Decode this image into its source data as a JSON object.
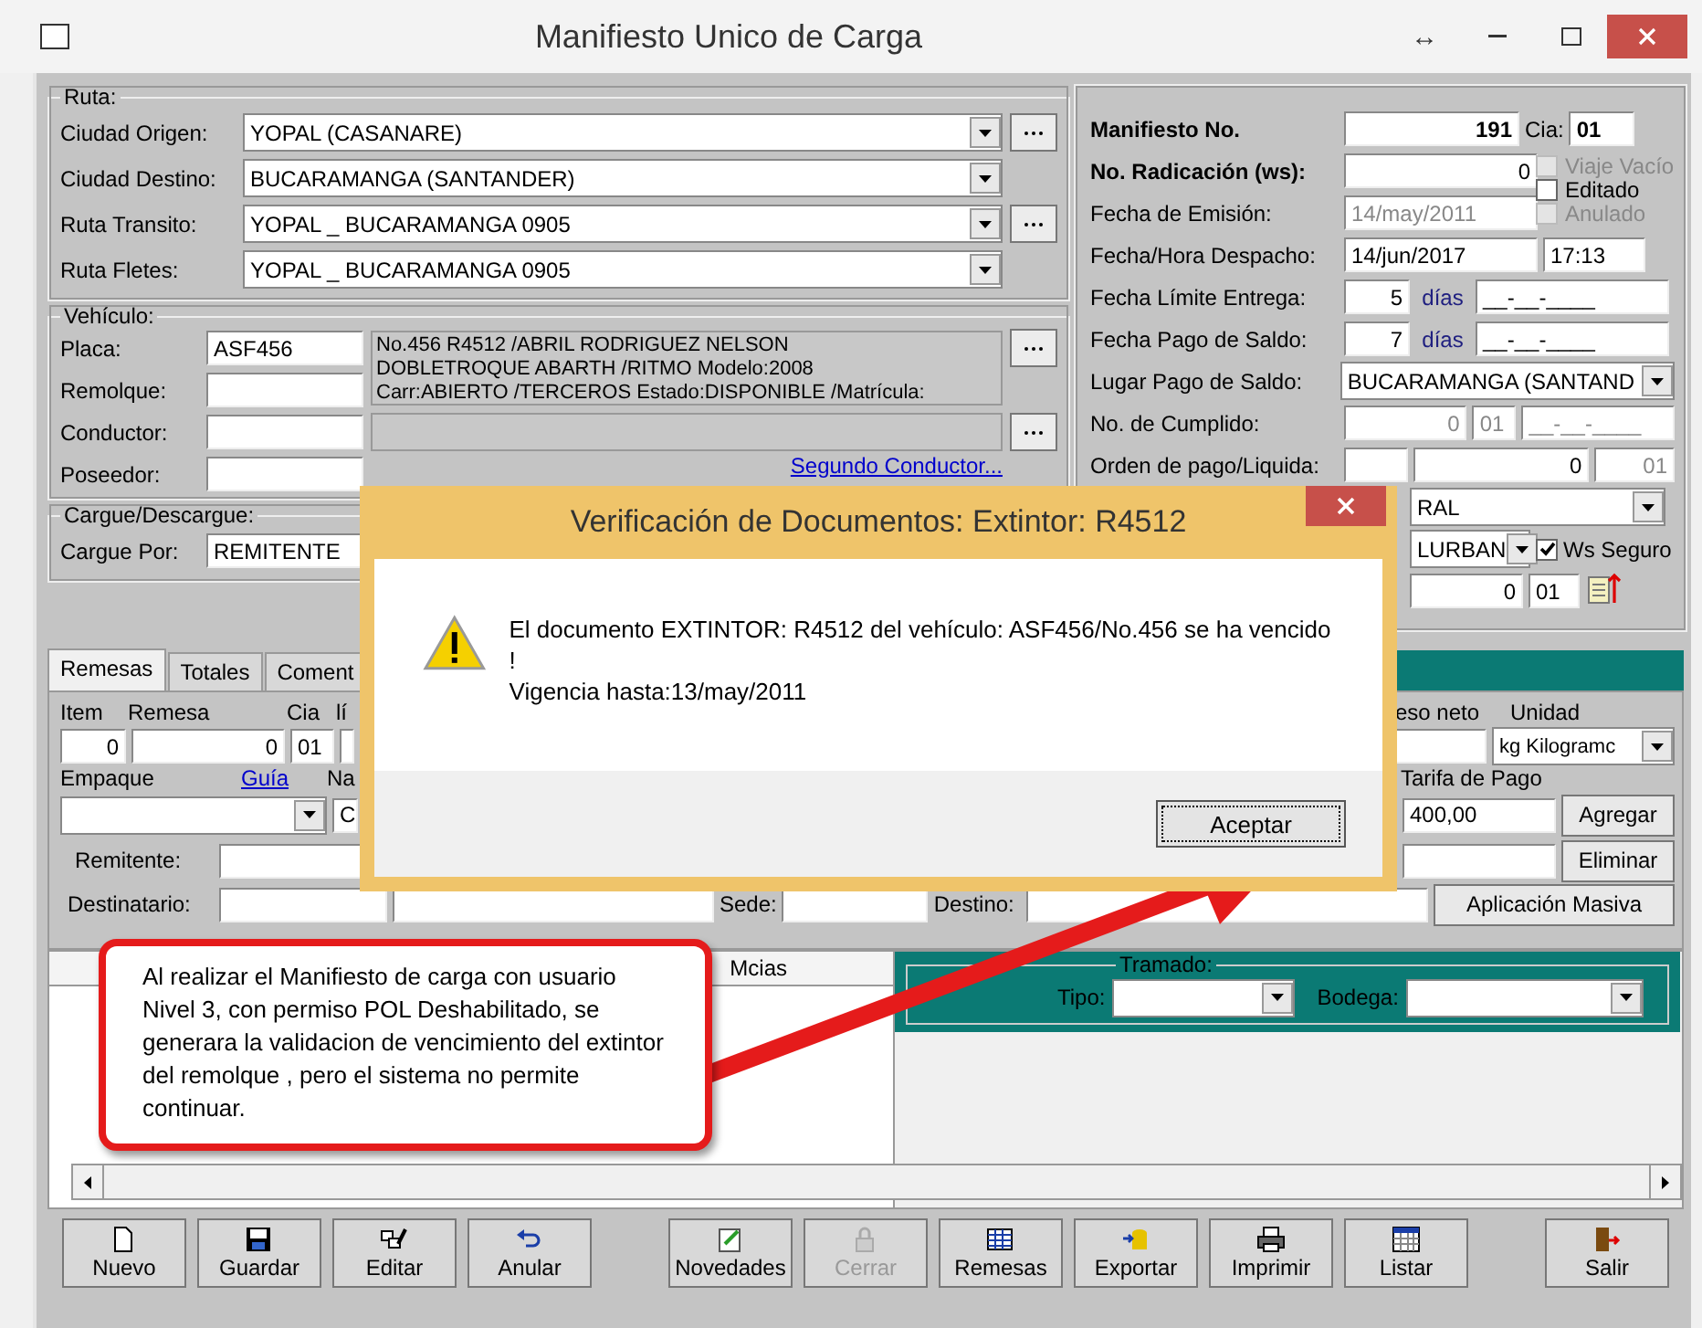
{
  "window": {
    "title": "Manifiesto Unico de Carga",
    "resize_glyph": "↔"
  },
  "ruta": {
    "legend": "Ruta:",
    "rows": [
      {
        "label": "Ciudad Origen:",
        "value": "YOPAL  (CASANARE)",
        "lookup": true
      },
      {
        "label": "Ciudad Destino:",
        "value": "BUCARAMANGA  (SANTANDER)",
        "lookup": false
      },
      {
        "label": "Ruta Transito:",
        "value": "YOPAL _ BUCARAMANGA 0905",
        "lookup": true
      },
      {
        "label": "Ruta Fletes:",
        "value": "YOPAL _ BUCARAMANGA 0905",
        "lookup": false
      }
    ]
  },
  "vehiculo": {
    "legend": "Vehículo:",
    "placa": {
      "label": "Placa:",
      "value": "ASF456"
    },
    "remolque": {
      "label": "Remolque:"
    },
    "conductor": {
      "label": "Conductor:"
    },
    "poseedor": {
      "label": "Poseedor:"
    },
    "info": [
      "No.456  R4512 /ABRIL RODRIGUEZ NELSON",
      "DOBLETROQUE ABARTH /RITMO Modelo:2008",
      "Carr:ABIERTO /TERCEROS Estado:DISPONIBLE /Matrícula:"
    ],
    "segundo_conductor": "Segundo Conductor..."
  },
  "cargue": {
    "legend": "Cargue/Descargue:",
    "label": "Cargue Por:",
    "value": "REMITENTE"
  },
  "summary": {
    "manifiesto": {
      "label": "Manifiesto No.",
      "value": "191"
    },
    "cia": {
      "label": "Cia:",
      "value": "01"
    },
    "radicacion": {
      "label": "No. Radicación (ws):",
      "value": "0"
    },
    "flags": [
      {
        "label": "Viaje Vacío",
        "checked": false,
        "disabled": true
      },
      {
        "label": "Editado",
        "checked": false,
        "disabled": false
      },
      {
        "label": "Anulado",
        "checked": false,
        "disabled": true
      }
    ],
    "emision": {
      "label": "Fecha de Emisión:",
      "value": "14/may/2011",
      "disabled": true
    },
    "despacho": {
      "label": "Fecha/Hora Despacho:",
      "date": "14/jun/2017",
      "time": "17:13"
    },
    "limite": {
      "label": "Fecha Límite Entrega:",
      "days": "5",
      "unit": "días",
      "date": "__-__-____"
    },
    "pago": {
      "label": "Fecha Pago de Saldo:",
      "days": "7",
      "unit": "días",
      "date": "__-__-____"
    },
    "lugar": {
      "label": "Lugar Pago de Saldo:",
      "value": "BUCARAMANGA  (SANTAND"
    },
    "cumplido": {
      "label": "No. de Cumplido:",
      "number": "0",
      "cia": "01",
      "date": "__-__-____"
    },
    "orden": {
      "label": "Orden de pago/Liquida:",
      "number": "0",
      "cia": "01"
    },
    "combo_1": "RAL",
    "combo_2": "LURBAN",
    "ws_seguro": {
      "label": "Ws Seguro",
      "checked": true
    },
    "last": {
      "number": "0",
      "cia": "01"
    }
  },
  "tabs": [
    {
      "label": "Remesas",
      "selected": true
    },
    {
      "label": "Totales",
      "selected": false
    },
    {
      "label": "Coment",
      "selected": false
    }
  ],
  "remesas": {
    "headers": [
      "Item",
      "Remesa",
      "Cia",
      "lí"
    ],
    "item": "0",
    "remesa": "0",
    "cia": "01",
    "peso_label": "eso neto",
    "unidad_label": "Unidad",
    "unidad": "kg  Kilogramc",
    "empaque_label": "Empaque",
    "guia_link": "Guía",
    "na_label": "Na",
    "c_value": "C",
    "tarifa_label": "Tarifa de Pago",
    "tarifa": "400,00",
    "remitente_label": "Remitente:",
    "destinatario_label": "Destinatario:",
    "sede_label": "Sede:",
    "destino_label": "Destino:",
    "buttons": [
      "Agregar",
      "Eliminar"
    ],
    "masiva": "Aplicación Masiva"
  },
  "grid": {
    "column": "Mcias"
  },
  "tramado": {
    "legend": "Tramado:",
    "tipo": "Tipo:",
    "bodega": "Bodega:"
  },
  "toolbar": [
    {
      "label": "Nuevo",
      "disabled": false
    },
    {
      "label": "Guardar",
      "disabled": false
    },
    {
      "label": "Editar",
      "disabled": false
    },
    {
      "label": "Anular",
      "disabled": false
    },
    {
      "label": "Novedades",
      "disabled": false
    },
    {
      "label": "Cerrar",
      "disabled": true
    },
    {
      "label": "Remesas",
      "disabled": false
    },
    {
      "label": "Exportar",
      "disabled": false
    },
    {
      "label": "Imprimir",
      "disabled": false
    },
    {
      "label": "Listar",
      "disabled": false
    },
    {
      "label": "Salir",
      "disabled": false
    }
  ],
  "dialog": {
    "title": "Verificación de Documentos: Extintor: R4512",
    "message": "El documento EXTINTOR: R4512 del vehículo: ASF456/No.456 se ha vencido !",
    "detail": "Vigencia hasta:13/may/2011",
    "button": "Aceptar"
  },
  "callout": {
    "text": "Al realizar el Manifiesto de carga con usuario Nivel 3, con permiso POL Deshabilitado, se generara la validacion de vencimiento del extintor del remolque , pero el sistema no permite continuar."
  }
}
